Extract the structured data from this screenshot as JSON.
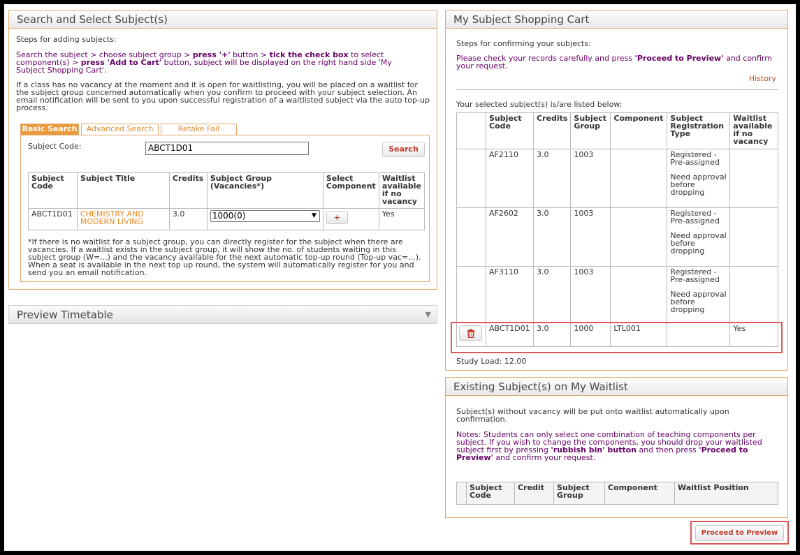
{
  "left": {
    "title": "Search and Select Subject(s)",
    "steps_heading": "Steps for adding subjects:",
    "steps": {
      "p1": "Search the subject > choose subject group > ",
      "p2": "press '+'",
      "p3": " button > ",
      "p4": "tick the check box",
      "p5": " to select component(s) > ",
      "p6": "press 'Add to Cart'",
      "p7": " button, subject will be displayed on the right hand side 'My Subject Shopping Cart'."
    },
    "waitlist_note": "If a class has no vacancy at the moment and it is open for waitlisting, you will be placed on a waitlist for the subject group concerned automatically when you confirm to proceed with your subject selection. An email notification will be sent to you upon successful registration of a waitlisted subject via the auto top-up process.",
    "tabs": [
      "Basic Search",
      "Advanced Search",
      "Retake Fail"
    ],
    "subject_code_label": "Subject Code:",
    "subject_code_value": "ABCT1D01",
    "search_button": "Search",
    "table_headers": [
      "Subject Code",
      "Subject Title",
      "Credits",
      "Subject Group (Vacancies*)",
      "Select Component",
      "Waitlist available if no vacancy"
    ],
    "row": {
      "code": "ABCT1D01",
      "title": "CHEMISTRY AND MODERN LIVING",
      "credits": "3.0",
      "group_selected": "1000(0)",
      "add_button": "+",
      "waitlist": "Yes"
    },
    "footnote": "*If there is no waitlist for a subject group, you can directly register for the subject when there are vacancies. If a waitlist exists in the subject group, it will show the no. of students waiting in this subject group (W=...) and the vacancy available for the next automatic top-up round (Top-up vac=...). When a seat is available in the next top up round, the system will automatically register for you and send you an email notification."
  },
  "preview": {
    "title": "Preview Timetable"
  },
  "cart": {
    "title": "My Subject Shopping Cart",
    "steps_heading": "Steps for confirming your subjects:",
    "steps_p1": "Please check your records carefully and press ",
    "steps_p2": "'Proceed to Preview'",
    "steps_p3": " and confirm your request.",
    "history_link": "History",
    "listed_label": "Your selected subject(s) is/are listed below:",
    "headers": [
      "Subject Code",
      "Credits",
      "Subject Group",
      "Component",
      "Subject Registration Type",
      "Waitlist available if no vacancy"
    ],
    "rows": [
      {
        "code": "AF2110",
        "credits": "3.0",
        "group": "1003",
        "component": "",
        "type1": "Registered - Pre-assigned",
        "type2": "Need approval before dropping",
        "waitlist": ""
      },
      {
        "code": "AF2602",
        "credits": "3.0",
        "group": "1003",
        "component": "",
        "type1": "Registered - Pre-assigned",
        "type2": "Need approval before dropping",
        "waitlist": ""
      },
      {
        "code": "AF3110",
        "credits": "3.0",
        "group": "1003",
        "component": "",
        "type1": "Registered - Pre-assigned",
        "type2": "Need approval before dropping",
        "waitlist": ""
      },
      {
        "code": "ABCT1D01",
        "credits": "3.0",
        "group": "1000",
        "component": "LTL001",
        "type1": "",
        "type2": "",
        "waitlist": "Yes"
      }
    ],
    "study_load": "Study Load: 12.00"
  },
  "waitlist": {
    "title": "Existing Subject(s) on My Waitlist",
    "info": "Subject(s) without vacancy will be put onto waitlist automatically upon confirmation.",
    "notes_p1": "Notes: Students can only select one combination of teaching components per subject. If you wish to change the components, you should drop your waitlisted subject first by pressing ",
    "notes_p2": "'rubbish bin' button",
    "notes_p3": " and then press ",
    "notes_p4": "'Proceed to Preview'",
    "notes_p5": " and confirm your request.",
    "headers": [
      "Subject Code",
      "Credit",
      "Subject Group",
      "Component",
      "Waitlist Position"
    ]
  },
  "proceed_button": "Proceed to Preview",
  "colors": {
    "accent_orange": "#e89a3c",
    "purple_text": "#660066",
    "highlight_red": "#e05555"
  }
}
